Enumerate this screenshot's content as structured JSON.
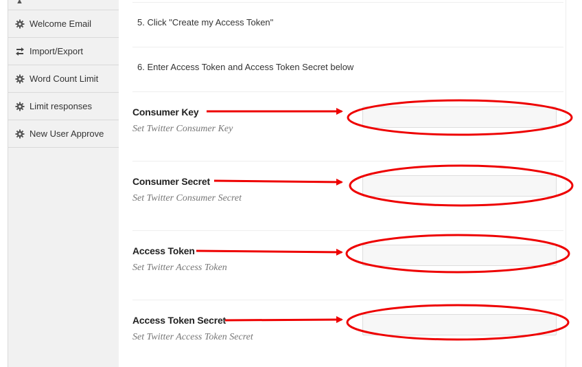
{
  "sidebar": {
    "items": [
      {
        "label": "Welcome Email",
        "icon": "gear-icon"
      },
      {
        "label": "Import/Export",
        "icon": "arrows-exchange-icon"
      },
      {
        "label": "Word Count Limit",
        "icon": "gear-icon"
      },
      {
        "label": "Limit responses",
        "icon": "gear-icon"
      },
      {
        "label": "New User Approve",
        "icon": "gear-icon"
      }
    ]
  },
  "steps": [
    "5.  Click \"Create my Access Token\"",
    "6.  Enter Access Token and Access Token Secret below"
  ],
  "fields": [
    {
      "label": "Consumer Key",
      "description": "Set Twitter Consumer Key",
      "value": ""
    },
    {
      "label": "Consumer Secret",
      "description": "Set Twitter Consumer Secret",
      "value": ""
    },
    {
      "label": "Access Token",
      "description": "Set Twitter Access Token",
      "value": ""
    },
    {
      "label": "Access Token Secret",
      "description": "Set Twitter Access Token Secret",
      "value": ""
    }
  ],
  "annotation_color": "#ee0000"
}
